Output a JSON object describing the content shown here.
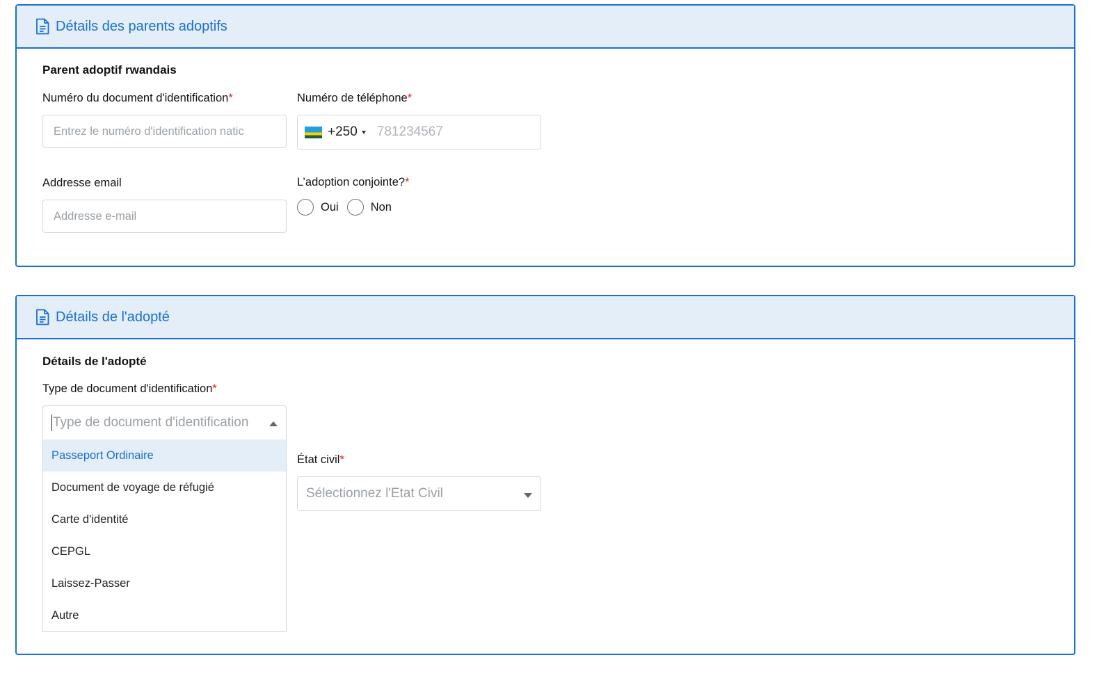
{
  "parents_card": {
    "header_title": "Détails des parents adoptifs",
    "section_title": "Parent adoptif rwandais",
    "id_number": {
      "label": "Numéro du document d'identification",
      "required_mark": "*",
      "placeholder": "Entrez le numéro d'identification natic"
    },
    "phone": {
      "label": "Numéro de téléphone",
      "required_mark": "*",
      "country_flag": "rwanda-flag",
      "dial_code": "+250",
      "placeholder": "781234567"
    },
    "email": {
      "label": "Addresse email",
      "placeholder": "Addresse e-mail"
    },
    "joint_adoption": {
      "label": "L’adoption conjointe?",
      "required_mark": "*",
      "options": [
        "Oui",
        "Non"
      ],
      "selected": null
    }
  },
  "adoptee_card": {
    "header_title": "Détails de l'adopté",
    "section_title": "Détails de l'adopté",
    "id_type": {
      "label": "Type de document d'identification",
      "required_mark": "*",
      "placeholder": "Type de document d'identification",
      "open": true,
      "options": [
        "Passeport Ordinaire",
        "Document de voyage de réfugié",
        "Carte d'identité",
        "CEPGL",
        "Laissez-Passer",
        "Autre"
      ],
      "highlighted_index": 0
    },
    "civil_status": {
      "label": "État civil",
      "required_mark": "*",
      "placeholder": "Sélectionnez l'Etat Civil"
    }
  },
  "colors": {
    "accent": "#1a6fd1",
    "header_bg": "#e3eef9",
    "required": "#e0202d",
    "border": "#d4d8dd"
  }
}
